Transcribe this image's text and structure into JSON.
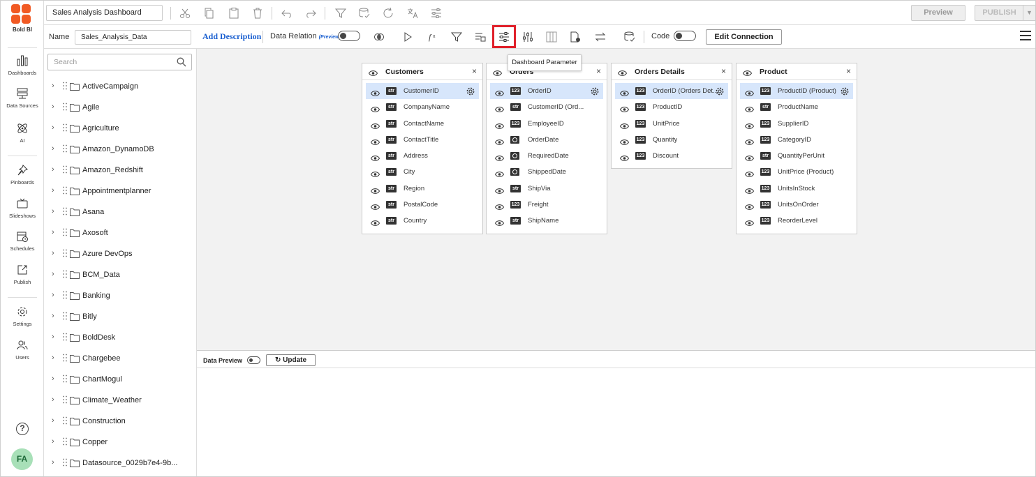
{
  "app": {
    "logo_text": "Bold BI"
  },
  "rail": {
    "items": [
      {
        "label": "Dashboards",
        "icon": "bar-chart-icon"
      },
      {
        "label": "Data Sources",
        "icon": "database-icon"
      },
      {
        "label": "AI",
        "icon": "atom-icon"
      },
      {
        "label": "Pinboards",
        "icon": "pin-icon"
      },
      {
        "label": "Slideshows",
        "icon": "tv-icon"
      },
      {
        "label": "Schedules",
        "icon": "calendar-clock-icon"
      },
      {
        "label": "Publish",
        "icon": "share-icon"
      },
      {
        "label": "Settings",
        "icon": "gear-icon"
      },
      {
        "label": "Users",
        "icon": "users-icon"
      }
    ],
    "help": "?",
    "avatar": "FA"
  },
  "topbar": {
    "dashboard_name": "Sales Analysis Dashboard",
    "preview_label": "Preview",
    "publish_label": "PUBLISH"
  },
  "toolbar": {
    "name_label": "Name",
    "name_value": "Sales_Analysis_Data",
    "add_description": "Add Description",
    "data_relation": "Data Relation",
    "preview_tag": "(Preview)",
    "code_label": "Code",
    "edit_connection": "Edit Connection",
    "tooltip": "Dashboard Parameter"
  },
  "left": {
    "search_placeholder": "Search",
    "items": [
      "ActiveCampaign",
      "Agile",
      "Agriculture",
      "Amazon_DynamoDB",
      "Amazon_Redshift",
      "Appointmentplanner",
      "Asana",
      "Axosoft",
      "Azure DevOps",
      "BCM_Data",
      "Banking",
      "Bitly",
      "BoldDesk",
      "Chargebee",
      "ChartMogul",
      "Climate_Weather",
      "Construction",
      "Copper",
      "Datasource_0029b7e4-9b..."
    ]
  },
  "tables": [
    {
      "name": "Customers",
      "columns": [
        {
          "name": "CustomerID",
          "type": "str"
        },
        {
          "name": "CompanyName",
          "type": "str"
        },
        {
          "name": "ContactName",
          "type": "str"
        },
        {
          "name": "ContactTitle",
          "type": "str"
        },
        {
          "name": "Address",
          "type": "str"
        },
        {
          "name": "City",
          "type": "str"
        },
        {
          "name": "Region",
          "type": "str"
        },
        {
          "name": "PostalCode",
          "type": "str"
        },
        {
          "name": "Country",
          "type": "str"
        }
      ]
    },
    {
      "name": "Orders",
      "columns": [
        {
          "name": "OrderID",
          "type": "123"
        },
        {
          "name": "CustomerID (Ord...",
          "type": "str"
        },
        {
          "name": "EmployeeID",
          "type": "123"
        },
        {
          "name": "OrderDate",
          "type": "date"
        },
        {
          "name": "RequiredDate",
          "type": "date"
        },
        {
          "name": "ShippedDate",
          "type": "date"
        },
        {
          "name": "ShipVia",
          "type": "str"
        },
        {
          "name": "Freight",
          "type": "123"
        },
        {
          "name": "ShipName",
          "type": "str"
        }
      ]
    },
    {
      "name": "Orders Details",
      "columns": [
        {
          "name": "OrderID (Orders Det...",
          "type": "123"
        },
        {
          "name": "ProductID",
          "type": "123"
        },
        {
          "name": "UnitPrice",
          "type": "123"
        },
        {
          "name": "Quantity",
          "type": "123"
        },
        {
          "name": "Discount",
          "type": "123"
        }
      ]
    },
    {
      "name": "Product",
      "columns": [
        {
          "name": "ProductID (Product)",
          "type": "123"
        },
        {
          "name": "ProductName",
          "type": "str"
        },
        {
          "name": "SupplierID",
          "type": "123"
        },
        {
          "name": "CategoryID",
          "type": "123"
        },
        {
          "name": "QuantityPerUnit",
          "type": "str"
        },
        {
          "name": "UnitPrice (Product)",
          "type": "123"
        },
        {
          "name": "UnitsInStock",
          "type": "123"
        },
        {
          "name": "UnitsOnOrder",
          "type": "123"
        },
        {
          "name": "ReorderLevel",
          "type": "123"
        }
      ]
    }
  ],
  "preview": {
    "label": "Data Preview",
    "update": "Update"
  },
  "colors": {
    "accent": "#1a5fd0",
    "highlight": "#e0202a",
    "selected_row": "#d7e6fb",
    "logo": "#f15a24"
  }
}
